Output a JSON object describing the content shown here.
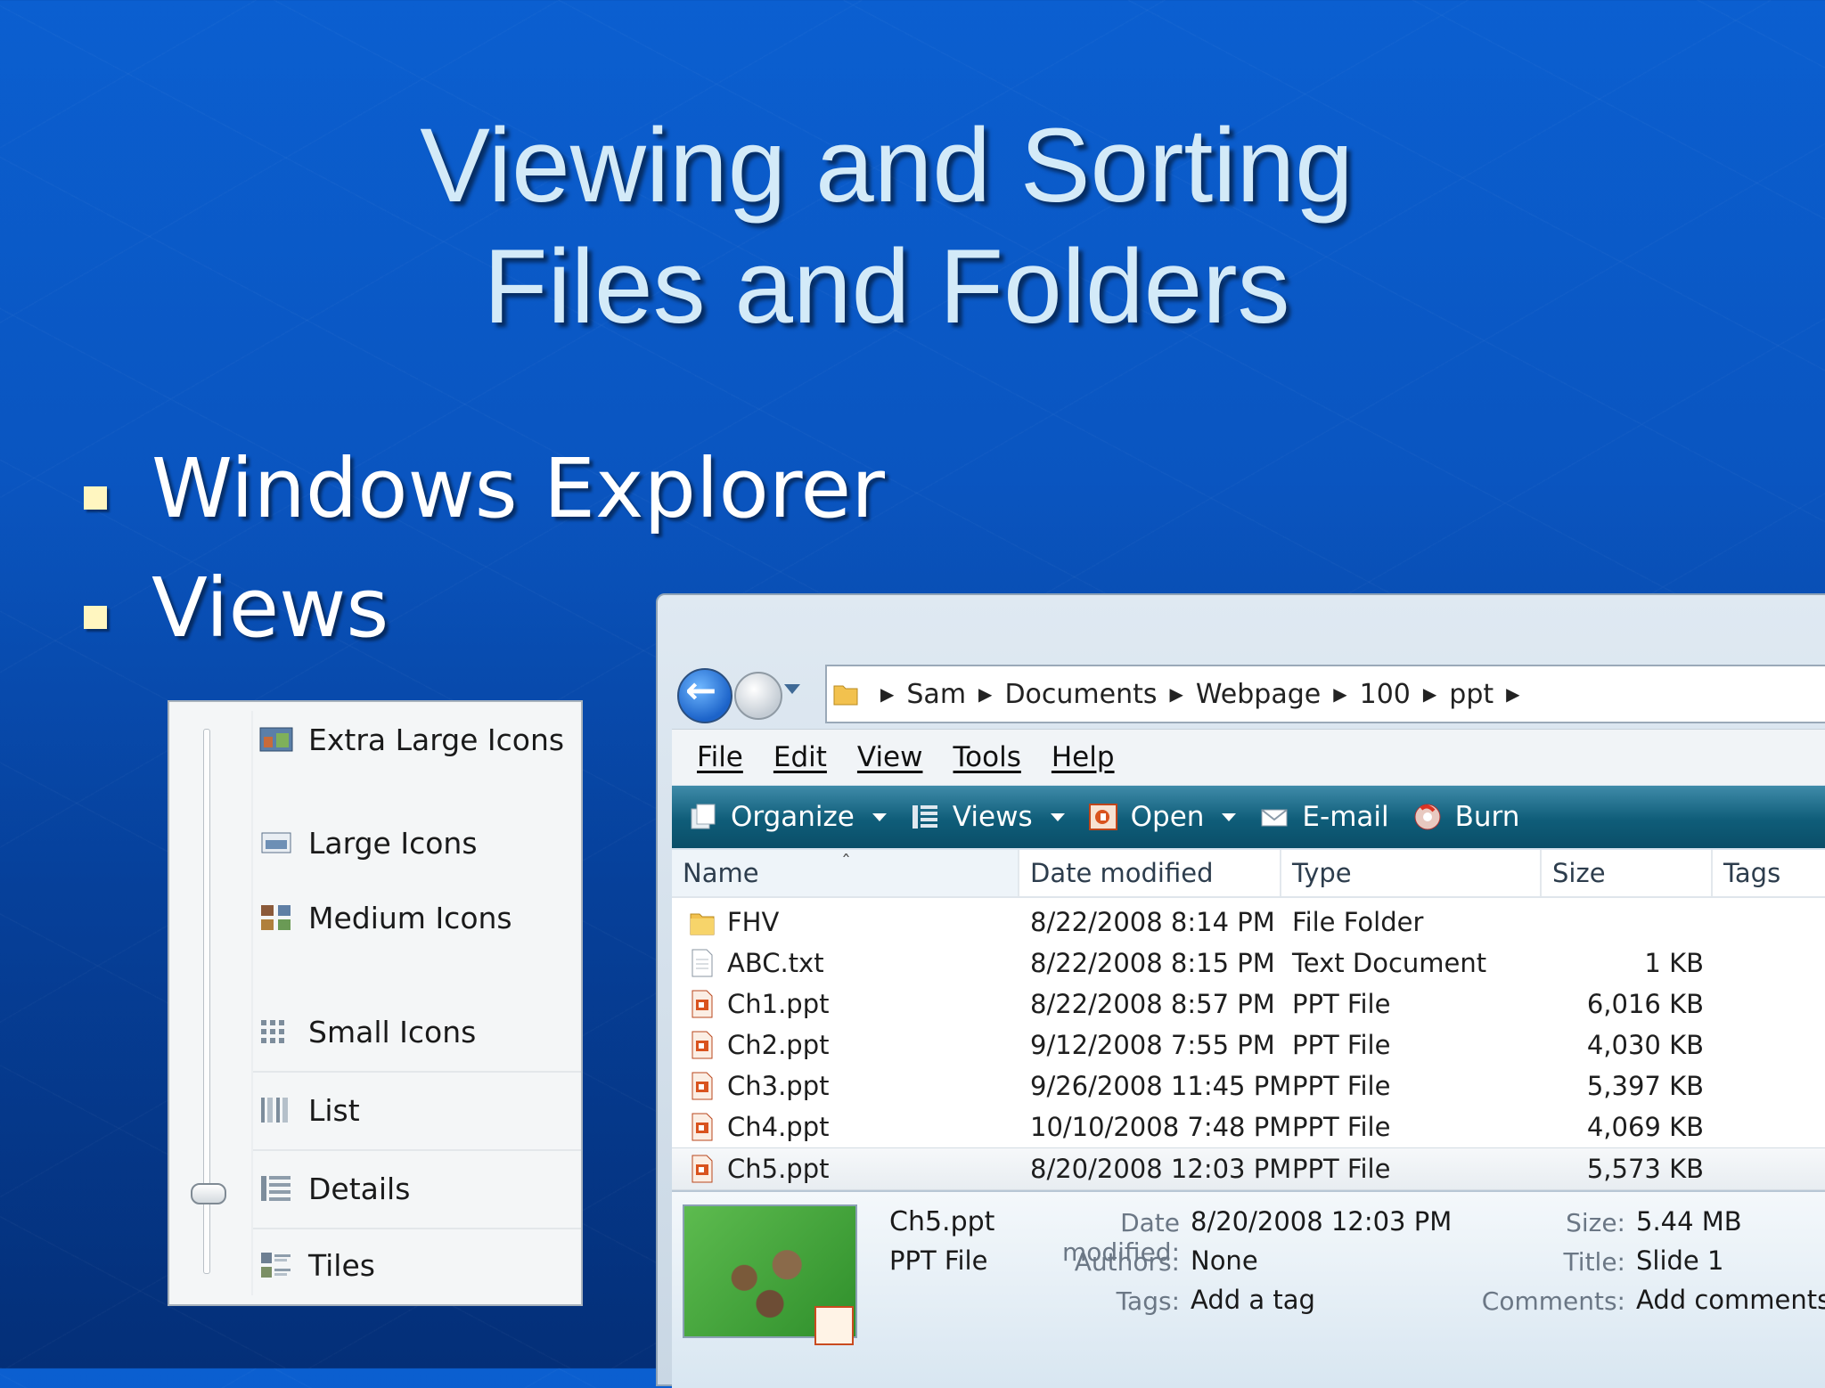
{
  "slide": {
    "title_line1": "Viewing and Sorting",
    "title_line2": "Files and Folders",
    "bullets": [
      "Windows Explorer",
      "Views"
    ]
  },
  "views_menu": {
    "items": [
      "Extra Large Icons",
      "Large Icons",
      "Medium Icons",
      "Small Icons",
      "List",
      "Details",
      "Tiles"
    ],
    "selected": "Details"
  },
  "explorer": {
    "breadcrumb": [
      "Sam",
      "Documents",
      "Webpage",
      "100",
      "ppt"
    ],
    "menu": [
      "File",
      "Edit",
      "View",
      "Tools",
      "Help"
    ],
    "toolbar": [
      "Organize",
      "Views",
      "Open",
      "E-mail",
      "Burn"
    ],
    "columns": [
      "Name",
      "Date modified",
      "Type",
      "Size",
      "Tags"
    ],
    "files": [
      {
        "name": "FHV",
        "date": "8/22/2008 8:14 PM",
        "type": "File Folder",
        "size": "",
        "icon": "folder-icon"
      },
      {
        "name": "ABC.txt",
        "date": "8/22/2008 8:15 PM",
        "type": "Text Document",
        "size": "1 KB",
        "icon": "text-file-icon"
      },
      {
        "name": "Ch1.ppt",
        "date": "8/22/2008 8:57 PM",
        "type": "PPT File",
        "size": "6,016 KB",
        "icon": "ppt-file-icon"
      },
      {
        "name": "Ch2.ppt",
        "date": "9/12/2008 7:55 PM",
        "type": "PPT File",
        "size": "4,030 KB",
        "icon": "ppt-file-icon"
      },
      {
        "name": "Ch3.ppt",
        "date": "9/26/2008 11:45 PM",
        "type": "PPT File",
        "size": "5,397 KB",
        "icon": "ppt-file-icon"
      },
      {
        "name": "Ch4.ppt",
        "date": "10/10/2008 7:48 PM",
        "type": "PPT File",
        "size": "4,069 KB",
        "icon": "ppt-file-icon"
      },
      {
        "name": "Ch5.ppt",
        "date": "8/20/2008 12:03 PM",
        "type": "PPT File",
        "size": "5,573 KB",
        "icon": "ppt-file-icon"
      }
    ],
    "details_pane": {
      "name": "Ch5.ppt",
      "type": "PPT File",
      "date_label": "Date modified:",
      "date_value": "8/20/2008 12:03 PM",
      "authors_label": "Authors:",
      "authors_value": "None",
      "tags_label": "Tags:",
      "tags_value": "Add a tag",
      "size_label": "Size:",
      "size_value": "5.44 MB",
      "title_label": "Title:",
      "title_value": "Slide 1",
      "comments_label": "Comments:",
      "comments_value": "Add comments"
    }
  },
  "colors": {
    "background": "#0a55c0",
    "title_text": "#d3eaf8",
    "bullet_marker": "#fff6c0",
    "command_bar": "#0f5d79"
  }
}
